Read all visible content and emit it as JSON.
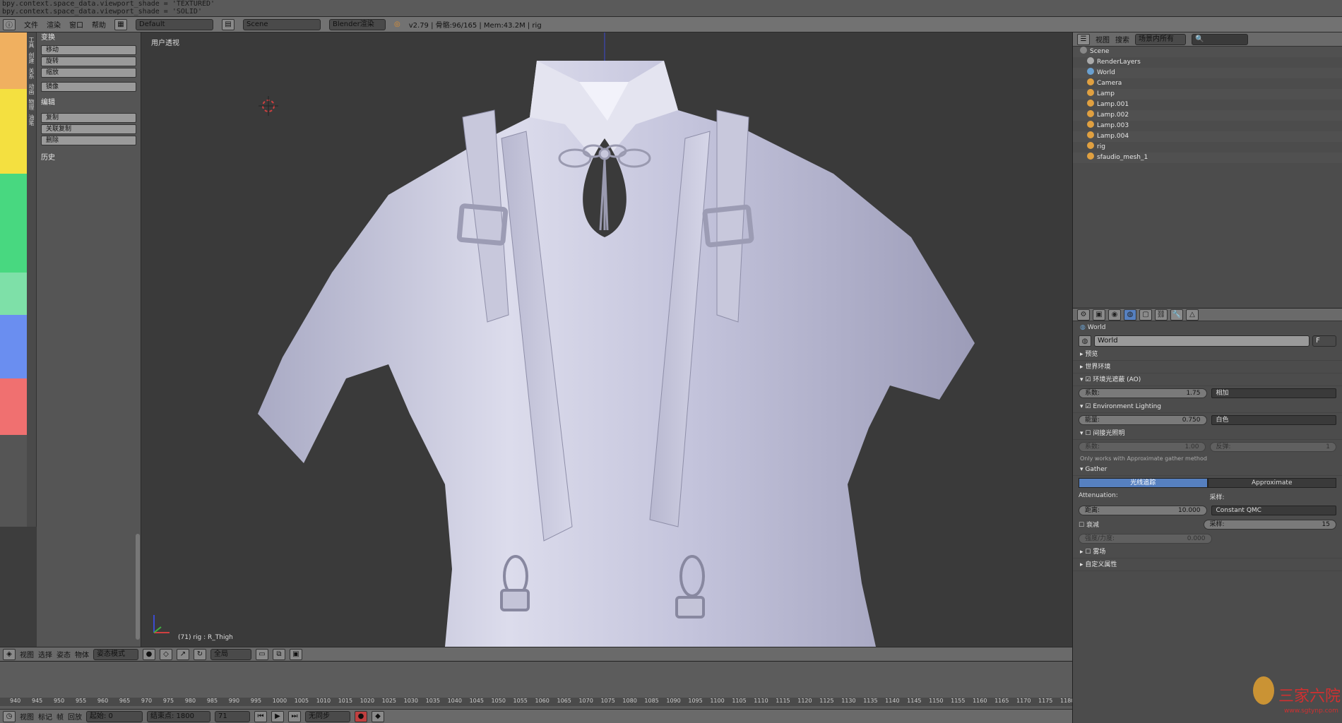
{
  "console": {
    "line1": "bpy.context.space_data.viewport_shade = 'TEXTURED'",
    "line2": "bpy.context.space_data.viewport_shade = 'SOLID'"
  },
  "infobar": {
    "menus": [
      "文件",
      "渲染",
      "窗口",
      "帮助"
    ],
    "layout": "Default",
    "scene": "Scene",
    "engine": "Blender渲染",
    "stats": "v2.79 | 骨骼:96/165 | Mem:43.2M | rig"
  },
  "toolshelf": {
    "panels": [
      {
        "title": "变换",
        "buttons": [
          "移动",
          "旋转",
          "缩放",
          "镜像"
        ]
      },
      {
        "title": "编辑",
        "buttons": [
          "复制",
          "关联复制",
          "删除"
        ]
      },
      {
        "title": "历史",
        "buttons": []
      }
    ],
    "tab_labels": [
      "工具",
      "创建",
      "关系",
      "动画",
      "物理",
      "油笔"
    ]
  },
  "viewport": {
    "label": "用户透视",
    "status": "(71) rig : R_Thigh"
  },
  "viewport_header": {
    "menus": [
      "视图",
      "选择",
      "姿态",
      "物体"
    ],
    "mode": "姿态模式",
    "pivot": "全局"
  },
  "timeline": {
    "ticks": [
      "940",
      "945",
      "950",
      "955",
      "960",
      "965",
      "970",
      "975",
      "980",
      "985",
      "990",
      "995",
      "1000",
      "1005",
      "1010",
      "1015",
      "1020",
      "1025",
      "1030",
      "1035",
      "1040",
      "1045",
      "1050",
      "1055",
      "1060",
      "1065",
      "1070",
      "1075",
      "1080",
      "1085",
      "1090",
      "1095",
      "1100",
      "1105",
      "1110",
      "1115",
      "1120",
      "1125",
      "1130",
      "1135",
      "1140",
      "1145",
      "1150",
      "1155",
      "1160",
      "1165",
      "1170",
      "1175",
      "1180"
    ],
    "menus": [
      "视图",
      "标记",
      "帧",
      "回放"
    ],
    "start": "起始: 0",
    "end": "结束点: 1800",
    "current": "71",
    "sync": "无同步"
  },
  "outliner": {
    "menus": [
      "视图",
      "搜索"
    ],
    "filter": "场景内所有",
    "items": [
      "Scene",
      "RenderLayers",
      "World",
      "Camera",
      "Lamp",
      "Lamp.001",
      "Lamp.002",
      "Lamp.003",
      "Lamp.004",
      "rig",
      "sfaudio_mesh_1"
    ]
  },
  "properties": {
    "breadcrumb": "World",
    "world_name": "World",
    "world_user": "F",
    "sections": {
      "preview": "预览",
      "world": "世界环境",
      "ao": "环境光遮蔽 (AO)",
      "env": "Environment Lighting",
      "indirect": "间接光照明",
      "gather": "Gather",
      "mist": "雾场",
      "custom": "自定义属性"
    },
    "ao_factor_label": "系数:",
    "ao_factor": "1.75",
    "ao_blend": "相加",
    "env_energy_label": "能量:",
    "env_energy": "0.750",
    "env_color": "白色",
    "indirect_factor_label": "系数:",
    "indirect_factor": "1.00",
    "indirect_bounces_label": "反弹:",
    "indirect_bounces": "1",
    "note": "Only works with Approximate gather method",
    "gather_tabs": [
      "光线追踪",
      "Approximate"
    ],
    "attenuation": "Attenuation:",
    "sampling": "采样:",
    "distance_label": "距离:",
    "distance": "10.000",
    "sampling_method": "Constant QMC",
    "falloff": "衰减",
    "samples_label": "采样:",
    "samples": "15",
    "strength_label": "强度/力度:",
    "strength": "0.000"
  },
  "watermark": {
    "text": "三家六院",
    "url": "www.sgtynp.com"
  }
}
